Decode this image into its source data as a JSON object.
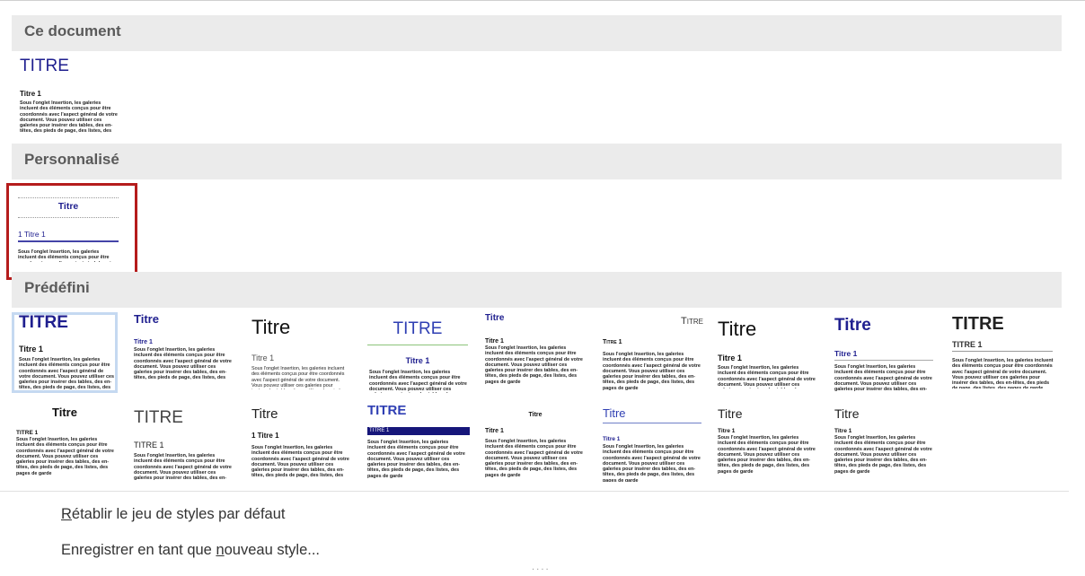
{
  "sections": {
    "document": "Ce document",
    "custom": "Personnalisé",
    "builtin": "Prédéfini"
  },
  "sample_text": "Sous l'onglet Insertion, les galeries incluent des éléments conçus pour être coordonnés avec l'aspect général de votre document. Vous pouvez utiliser ces galeries pour insérer des tables, des en-têtes, des pieds de page, des listes, des pages de garde",
  "doc_style": {
    "title": "TITRE",
    "heading": "Titre 1"
  },
  "custom_style": {
    "title": "Titre",
    "heading": "1  Titre 1"
  },
  "builtin_styles": [
    {
      "title": "TITRE",
      "heading": "Titre 1"
    },
    {
      "title": "Titre",
      "heading": "Titre 1"
    },
    {
      "title": "Titre",
      "heading": "Titre 1"
    },
    {
      "title": "TITRE",
      "heading": "Titre 1"
    },
    {
      "title": "Titre",
      "heading": "Titre 1"
    },
    {
      "title": "Titre",
      "heading": "Titre 1"
    },
    {
      "title": "Titre",
      "heading": "Titre 1"
    },
    {
      "title": "Titre",
      "heading": "Titre 1"
    },
    {
      "title": "TITRE",
      "heading": "TITRE 1"
    },
    {
      "title": "Titre",
      "heading": "TITRE 1"
    },
    {
      "title": "TITRE",
      "heading": "TITRE 1"
    },
    {
      "title": "Titre",
      "heading": "1  Titre 1"
    },
    {
      "title": "TITRE",
      "heading": "TITRE 1"
    },
    {
      "title": "Titre",
      "heading": "Titre 1"
    },
    {
      "title": "Titre",
      "heading": "Titre 1"
    },
    {
      "title": "Titre",
      "heading": "Titre 1"
    },
    {
      "title": "Titre",
      "heading": "Titre 1"
    }
  ],
  "commands": {
    "reset": {
      "before": "",
      "key": "R",
      "after": "établir le jeu de styles par défaut"
    },
    "save": {
      "before": "Enregistrer en tant que ",
      "key": "n",
      "after": "ouveau style..."
    }
  },
  "resize_grip": "····",
  "colors": {
    "highlight": "#b51c1c",
    "selection": "#c5d9f1",
    "header_bg": "#ebebeb",
    "navy": "#1f1f8f"
  }
}
